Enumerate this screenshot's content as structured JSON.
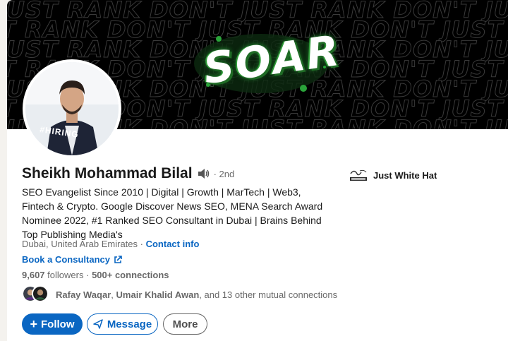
{
  "banner": {
    "pattern_text": "JUST RANK DON'T JUST RANK DON'T JUST RANK DON'T",
    "logo_text": "SOAR"
  },
  "profile": {
    "avatar_badge": "#HIRING",
    "name": "Sheikh Mohammad Bilal",
    "degree": "· 2nd",
    "headline": "SEO Evangelist Since 2010 | Digital | Growth | MarTech | Web3, Fintech & Crypto. Google Discover News SEO, MENA Search Award Nominee 2022, #1 Ranked SEO Consultant in Dubai | Brains Behind Top Publishing Media's",
    "location": "Dubai, United Arab Emirates ·",
    "contact_info": "Contact info",
    "book_consultancy": "Book a Consultancy",
    "followers_count": "9,607",
    "followers_label": "followers",
    "connections_sep": "·",
    "connections": "500+ connections",
    "mutual": {
      "name1": "Rafay Waqar",
      "sep": ",",
      "name2": "Umair Khalid Awan",
      "rest": ", and 13 other mutual connections"
    }
  },
  "company": {
    "name": "Just White Hat"
  },
  "actions": {
    "follow": "Follow",
    "message": "Message",
    "more": "More"
  },
  "colors": {
    "accent": "#0a66c2",
    "hiring_purple": "#7a3fd0",
    "banner_green": "#2f9c38"
  }
}
